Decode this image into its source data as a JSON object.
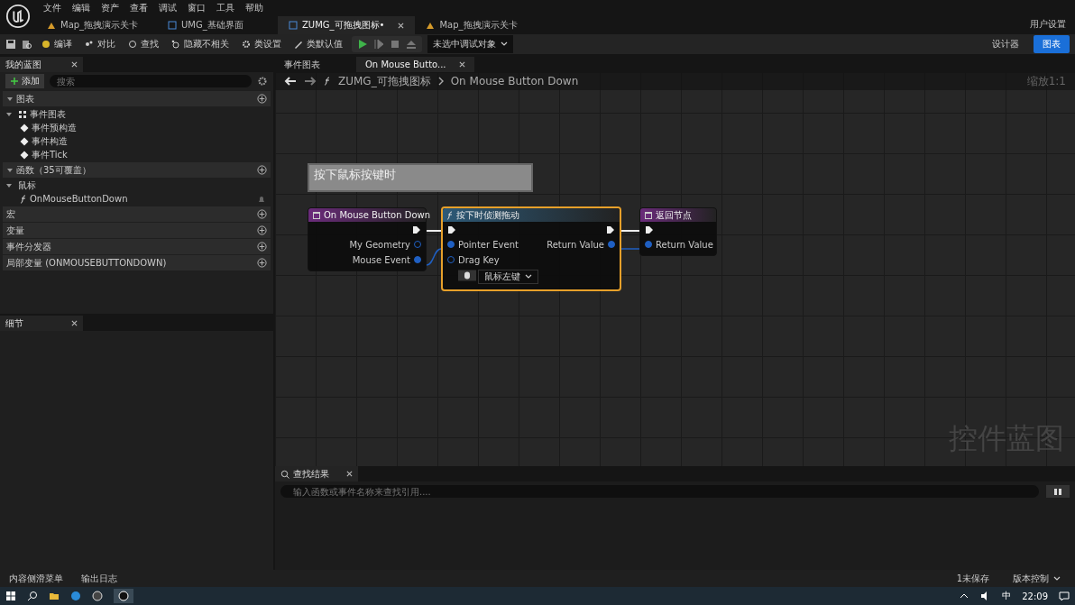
{
  "menu": [
    "文件",
    "编辑",
    "资产",
    "查看",
    "调试",
    "窗口",
    "工具",
    "帮助"
  ],
  "doc_tabs": [
    {
      "label": "Map_拖拽演示关卡",
      "kind": "level",
      "selected": false
    },
    {
      "label": "UMG_基础界面",
      "kind": "widget",
      "selected": false
    },
    {
      "label": "ZUMG_可拖拽图标•",
      "kind": "widget",
      "selected": true
    },
    {
      "label": "Map_拖拽演示关卡",
      "kind": "level",
      "selected": false
    }
  ],
  "user_settings": "用户设置",
  "toolbar": [
    {
      "label": "编译",
      "kind": "compile"
    },
    {
      "label": "对比",
      "kind": "diff"
    },
    {
      "label": "查找",
      "kind": "find"
    },
    {
      "label": "隐藏不相关",
      "kind": "hide"
    },
    {
      "label": "类设置",
      "kind": "settings"
    },
    {
      "label": "类默认值",
      "kind": "defaults"
    }
  ],
  "debug_target": "未选中调试对象",
  "modes": [
    {
      "label": "设计器",
      "selected": false
    },
    {
      "label": "图表",
      "selected": true
    }
  ],
  "my_blueprint": {
    "tab": "我的蓝图",
    "add": "添加",
    "search_placeholder": "搜索",
    "sections": [
      {
        "label": "图表",
        "children": [
          {
            "label": "事件图表",
            "kind": "graph",
            "children": [
              {
                "label": "事件预构造",
                "kind": "event"
              },
              {
                "label": "事件构造",
                "kind": "event"
              },
              {
                "label": "事件Tick",
                "kind": "event"
              }
            ]
          }
        ]
      },
      {
        "label": "函数（35可覆盖）",
        "children": [
          {
            "label": "鼠标",
            "kind": "category",
            "children": [
              {
                "label": "OnMouseButtonDown",
                "kind": "function"
              }
            ]
          }
        ]
      },
      {
        "label": "宏"
      },
      {
        "label": "变量"
      },
      {
        "label": "事件分发器"
      },
      {
        "label": "局部变量 (ONMOUSEBUTTONDOWN)"
      }
    ]
  },
  "details": {
    "tab": "细节"
  },
  "graph_tabs": [
    {
      "label": "事件图表",
      "selected": false
    },
    {
      "label": "On Mouse Butto...",
      "selected": true
    }
  ],
  "breadcrumb": [
    "ZUMG_可拖拽图标",
    "On Mouse Button Down"
  ],
  "zoom": "缩放1:1",
  "graph_type": "控件蓝图",
  "comment": "按下鼠标按键时",
  "nodes": [
    {
      "title": "On Mouse Button Down",
      "kind": "event",
      "selected": false,
      "outputs": [
        {
          "label": "My Geometry",
          "connected": false
        },
        {
          "label": "Mouse Event",
          "connected": true
        }
      ]
    },
    {
      "title": "按下时侦测拖动",
      "kind": "function",
      "selected": true,
      "inputs": [
        {
          "label": "Pointer Event",
          "connected": true
        },
        {
          "label": "Drag Key",
          "connected": false,
          "value": "鼠标左键"
        }
      ],
      "outputs": [
        {
          "label": "Return Value",
          "connected": true
        }
      ]
    },
    {
      "title": "返回节点",
      "kind": "result",
      "selected": false,
      "inputs": [
        {
          "label": "Return Value",
          "connected": true
        }
      ]
    }
  ],
  "find_results": {
    "tab": "查找结果",
    "placeholder": "输入函数或事件名称来查找引用...."
  },
  "status_bar": {
    "left": [
      "内容侧滑菜单",
      "输出日志"
    ],
    "unsaved": "1未保存",
    "source_control": "版本控制"
  },
  "taskbar": {
    "ime": "中",
    "time": "22:09"
  }
}
